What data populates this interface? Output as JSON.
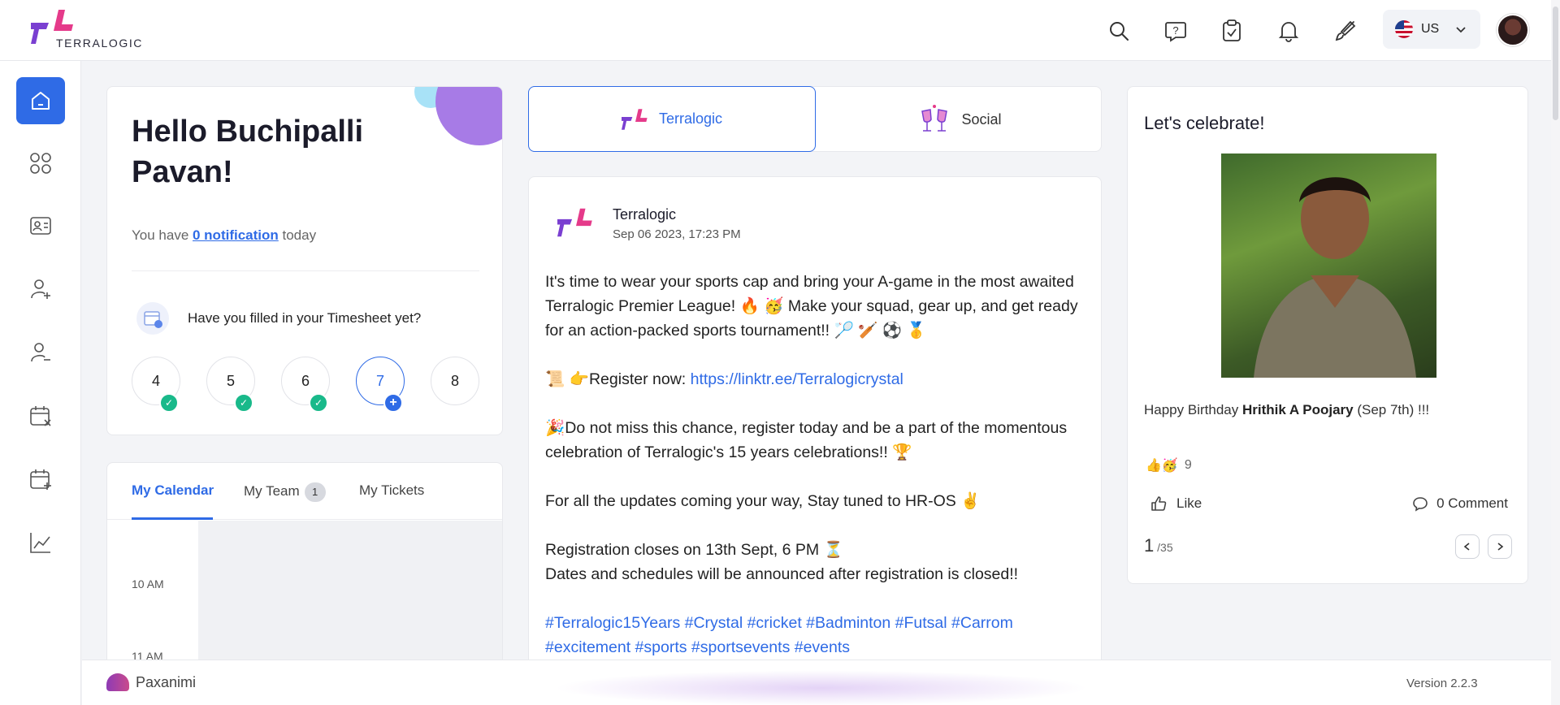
{
  "app": {
    "brand": "TERRALOGIC",
    "language_label": "US"
  },
  "greeting": {
    "title": "Hello Buchipalli Pavan!",
    "notif_prefix": "You have ",
    "notif_link": "0 notification",
    "notif_suffix": " today",
    "timesheet_question": "Have you filled in your Timesheet yet?",
    "days": [
      {
        "num": "4",
        "status": "done"
      },
      {
        "num": "5",
        "status": "done"
      },
      {
        "num": "6",
        "status": "done"
      },
      {
        "num": "7",
        "status": "add"
      },
      {
        "num": "8",
        "status": "none"
      }
    ]
  },
  "calendar": {
    "tabs": [
      "My Calendar",
      "My Team",
      "My Tickets"
    ],
    "team_badge": "1",
    "times": [
      "10 AM",
      "11 AM"
    ]
  },
  "feed": {
    "tabs": [
      "Terralogic",
      "Social"
    ],
    "post": {
      "author": "Terralogic",
      "date": "Sep 06 2023, 17:23 PM",
      "p1": "It's time to wear your sports cap and bring your A-game in the most awaited Terralogic Premier League! 🔥 🥳 Make your squad, gear up, and get ready for an action-packed sports tournament!! 🏸 🏏 ⚽ 🥇",
      "p2_prefix": "📜 👉Register now: ",
      "p2_link": "https://linktr.ee/Terralogicrystal",
      "p3": "🎉Do not miss this chance, register today and be a part of the momentous celebration of Terralogic's 15 years celebrations!! 🏆",
      "p4": "For all the updates coming your way, Stay tuned to HR-OS ✌",
      "p5a": "Registration closes on 13th Sept, 6 PM ⏳",
      "p5b": "Dates and schedules will be announced after registration is closed!!",
      "hashtags": "#Terralogic15Years #Crystal #cricket #Badminton #Futsal #Carrom #excitement #sports #sportsevents #events"
    }
  },
  "celebrate": {
    "title": "Let's celebrate!",
    "bday_prefix": "Happy Birthday ",
    "bday_name": "Hrithik A Poojary",
    "bday_suffix": " (Sep 7th) !!!",
    "reaction_emojis": "👍🥳",
    "reaction_count": "9",
    "like_label": "Like",
    "comment_label": "0 Comment",
    "page_current": "1",
    "page_total": " /35"
  },
  "footer": {
    "brand": "Paxanimi",
    "version": "Version 2.2.3"
  },
  "colors": {
    "accent": "#2f6be6",
    "success": "#19b98a",
    "brand_pink": "#e53a8a",
    "brand_purple": "#7a3fd1"
  }
}
